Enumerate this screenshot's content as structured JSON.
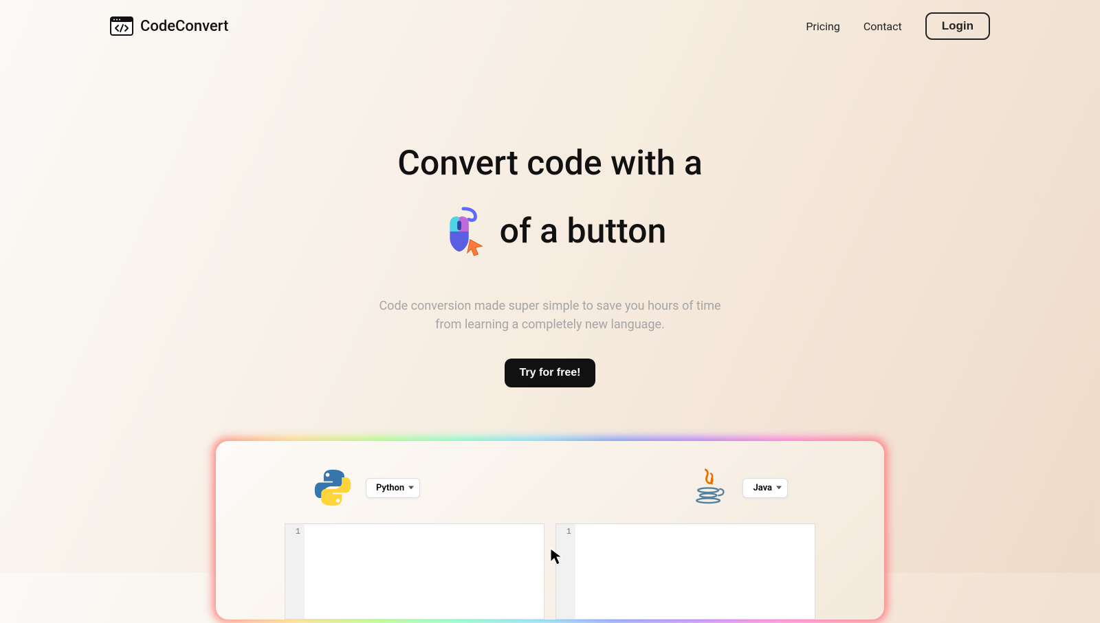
{
  "header": {
    "brand": "CodeConvert",
    "nav": {
      "pricing": "Pricing",
      "contact": "Contact",
      "login": "Login"
    }
  },
  "hero": {
    "title_line1": "Convert code with a",
    "title_line2_suffix": "of a button",
    "subtitle_line1": "Code conversion made super simple to save you hours of time",
    "subtitle_line2": "from learning a completely new language.",
    "cta": "Try for free!"
  },
  "demo": {
    "left_lang": "Python",
    "right_lang": "Java",
    "left_editor": {
      "line_number": "1"
    },
    "right_editor": {
      "line_number": "1"
    }
  }
}
